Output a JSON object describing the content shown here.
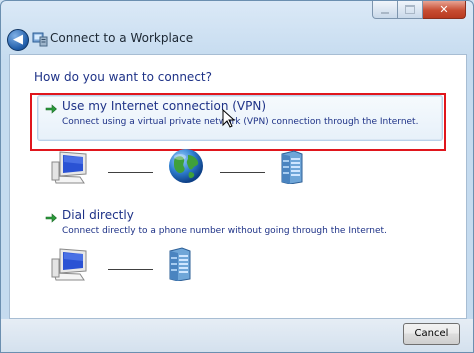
{
  "window": {
    "title": "Connect to a Workplace",
    "close_glyph": "✕",
    "back_glyph": "◀"
  },
  "main": {
    "question": "How do you want to connect?",
    "options": [
      {
        "title": "Use my Internet connection (VPN)",
        "description": "Connect using a virtual private network (VPN) connection through the Internet.",
        "icon": "green-arrow-icon"
      },
      {
        "title": "Dial directly",
        "description": "Connect directly to a phone number without going through the Internet.",
        "icon": "green-arrow-icon"
      }
    ]
  },
  "footer": {
    "cancel_label": "Cancel"
  },
  "colors": {
    "link_blue": "#1e3287",
    "highlight_red": "#e0161d",
    "arrow_green": "#2a9a3a"
  }
}
